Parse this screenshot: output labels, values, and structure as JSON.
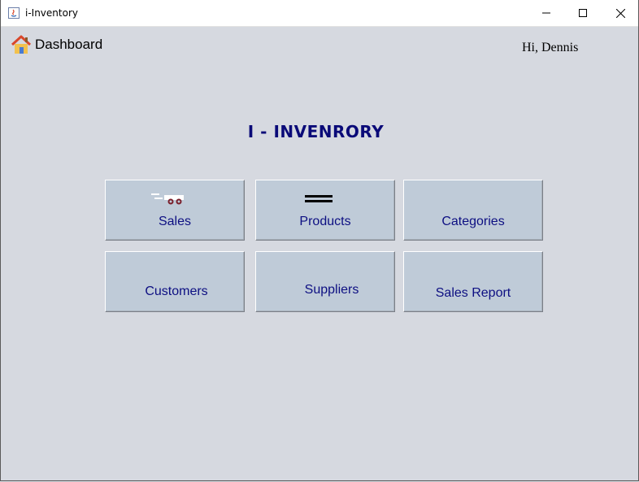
{
  "window": {
    "title": "i-Inventory"
  },
  "header": {
    "dashboard_label": "Dashboard",
    "greeting": "Hi, Dennis"
  },
  "main": {
    "heading": "I - INVENRORY",
    "tiles": [
      {
        "label": "Sales",
        "icon": "delivery-truck-icon"
      },
      {
        "label": "Products",
        "icon": "menu-bars-icon"
      },
      {
        "label": "Categories",
        "icon": "none"
      },
      {
        "label": "Customers",
        "icon": "none"
      },
      {
        "label": "Suppliers",
        "icon": "none"
      },
      {
        "label": "Sales Report",
        "icon": "none"
      }
    ]
  },
  "colors": {
    "background": "#d6d9e0",
    "tile": "#bfcbd8",
    "tile_text": "#0d0f82",
    "heading": "#0a0a78"
  }
}
